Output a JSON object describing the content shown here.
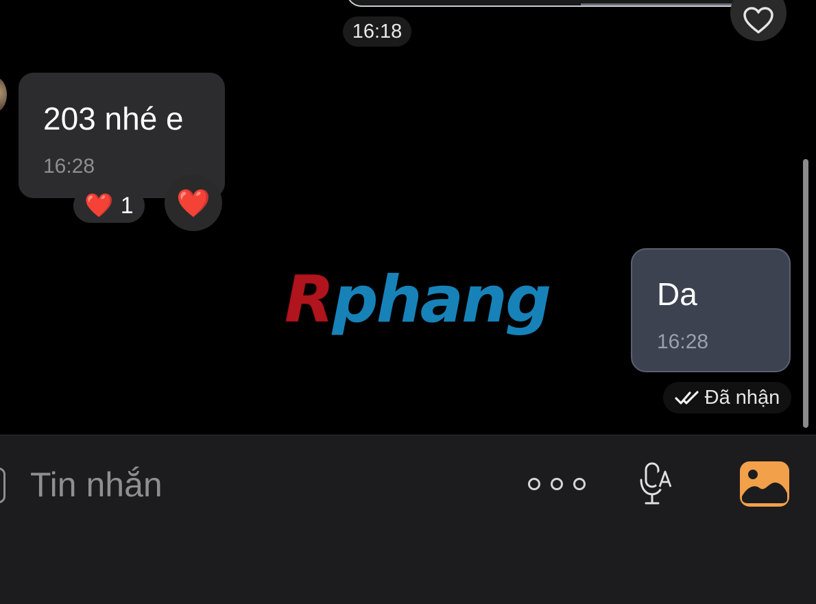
{
  "chat": {
    "top_time": "16:18",
    "incoming": {
      "text": "203 nhé e",
      "time": "16:28",
      "reaction_emoji": "❤️",
      "reaction_count": "1",
      "add_reaction_emoji": "❤️"
    },
    "watermark": {
      "first": "R",
      "rest": "phang"
    },
    "outgoing": {
      "text": "Da",
      "time": "16:28",
      "status": "Đã nhận",
      "status_icon": "double-check-icon"
    }
  },
  "composer": {
    "placeholder": "Tin nhắn",
    "more_icon": "more-dots-icon",
    "mic_icon": "voice-to-text-icon",
    "photo_icon": "photo-icon"
  },
  "colors": {
    "background": "#000000",
    "incoming_bubble": "#2c2c2e",
    "outgoing_bubble": "#3c4250",
    "photo_accent": "#f3a04a",
    "watermark_red": "#b0141c",
    "watermark_blue": "#1782b8"
  }
}
